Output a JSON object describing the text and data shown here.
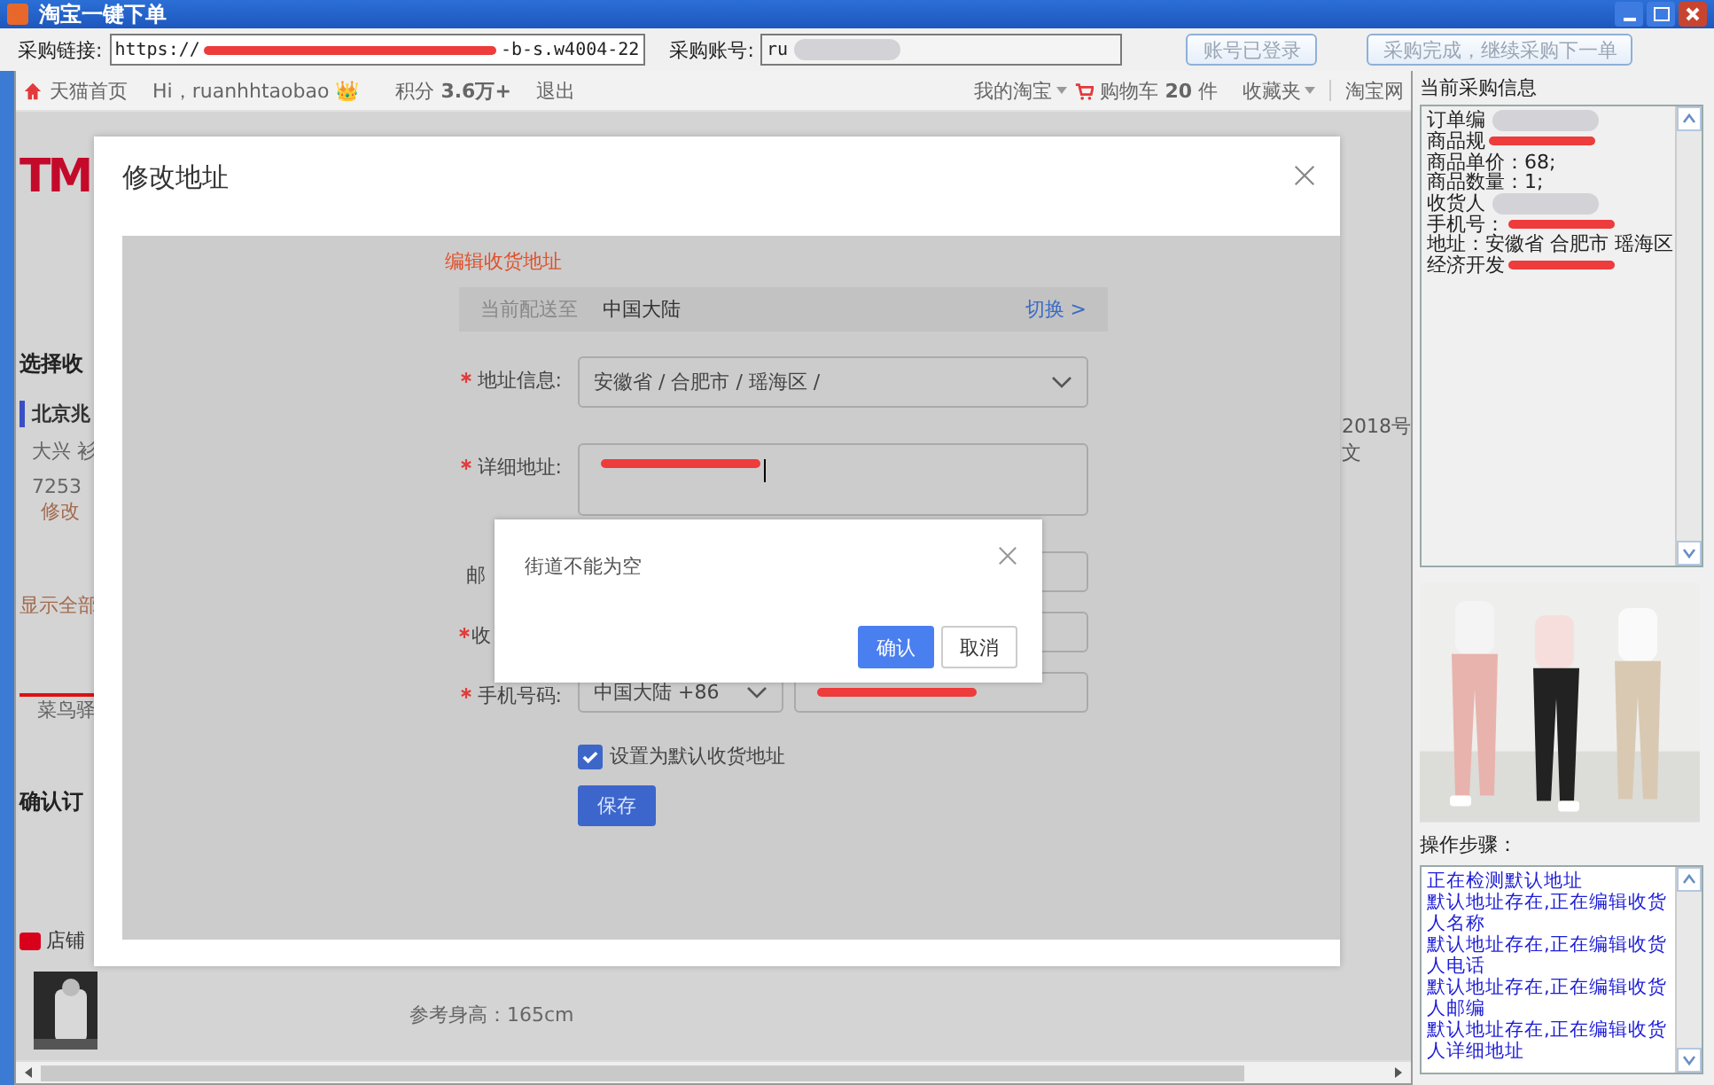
{
  "window": {
    "title": "淘宝一键下单"
  },
  "toolbar": {
    "link_label": "采购链接:",
    "link_start": "https://",
    "link_end": "-b-s.w4004-22",
    "account_label": "采购账号:",
    "account_value": "ru",
    "buttons": [
      {
        "label": "账号已登录",
        "disabled": true
      },
      {
        "label": "采购完成，继续采购下一单",
        "disabled": true
      }
    ]
  },
  "nav": {
    "left": [
      "天猫首页",
      "Hi，ruanhhtaobao 👑"
    ],
    "points": "积分 **3.6万+**",
    "logout": "退出",
    "right": [
      "我的淘宝"
    ],
    "cart": "购物车 **20** 件",
    "favorites": "收藏夹",
    "site": "淘宝网"
  },
  "page": {
    "logo": "TM",
    "left_texts": [
      {
        "text": "选择收",
        "kind": "heading"
      },
      {
        "text": "北京兆",
        "kind": "name"
      },
      {
        "text": "大兴 衫",
        "kind": "plain"
      },
      {
        "text": "7253",
        "kind": "plain"
      },
      {
        "text": "修改",
        "kind": "link"
      },
      {
        "text": "显示全部",
        "kind": "link"
      },
      {
        "text": "菜鸟驿",
        "kind": "tab"
      },
      {
        "text": "确认订",
        "kind": "heading"
      },
      {
        "text": "店铺",
        "kind": "shop"
      }
    ],
    "right_text": "2018号文",
    "product_note": "参考身高：165cm"
  },
  "modal": {
    "title": "修改地址",
    "section_title": "编辑收货地址",
    "delivery_label": "当前配送至",
    "delivery_value": "中国大陆",
    "switch": "切换 >",
    "fields": [
      {
        "label": "地址信息:",
        "kind": "select",
        "required": true,
        "value": "安徽省 / 合肥市 / 瑶海区 /"
      },
      {
        "label": "详细地址:",
        "kind": "textarea",
        "required": true,
        "redacted": true
      },
      {
        "label": "邮",
        "kind": "input",
        "required": false
      },
      {
        "label": "收",
        "kind": "input",
        "required": true
      },
      {
        "label": "手机号码:",
        "kind": "phone",
        "required": true,
        "value": "中国大陆 +86",
        "redacted": true
      }
    ],
    "default_checkbox": {
      "label": "设置为默认收货地址",
      "checked": true
    },
    "save": "保存"
  },
  "alert": {
    "message": "街道不能为空",
    "confirm": "确认",
    "cancel": "取消"
  },
  "info": {
    "title": "当前采购信息",
    "lines": [
      {
        "text": "订单编",
        "redacted": true
      },
      {
        "text": "商品规",
        "redacted": true
      },
      {
        "text": "商品单价：68;",
        "redacted": false
      },
      {
        "text": "商品数量：1;",
        "redacted": false
      },
      {
        "text": "收货人",
        "redacted": true
      },
      {
        "text": "手机号：",
        "redacted": true
      },
      {
        "text": "地址：安徽省 合肥市 瑶海区",
        "redacted": false
      },
      {
        "text": "经济开发",
        "redacted": true
      }
    ]
  },
  "steps": {
    "title": "操作步骤：",
    "items": [
      "正在检测默认地址",
      "默认地址存在,正在编辑收货人名称",
      "默认地址存在,正在编辑收货人电话",
      "默认地址存在,正在编辑收货人邮编",
      "默认地址存在,正在编辑收货人详细地址"
    ]
  }
}
